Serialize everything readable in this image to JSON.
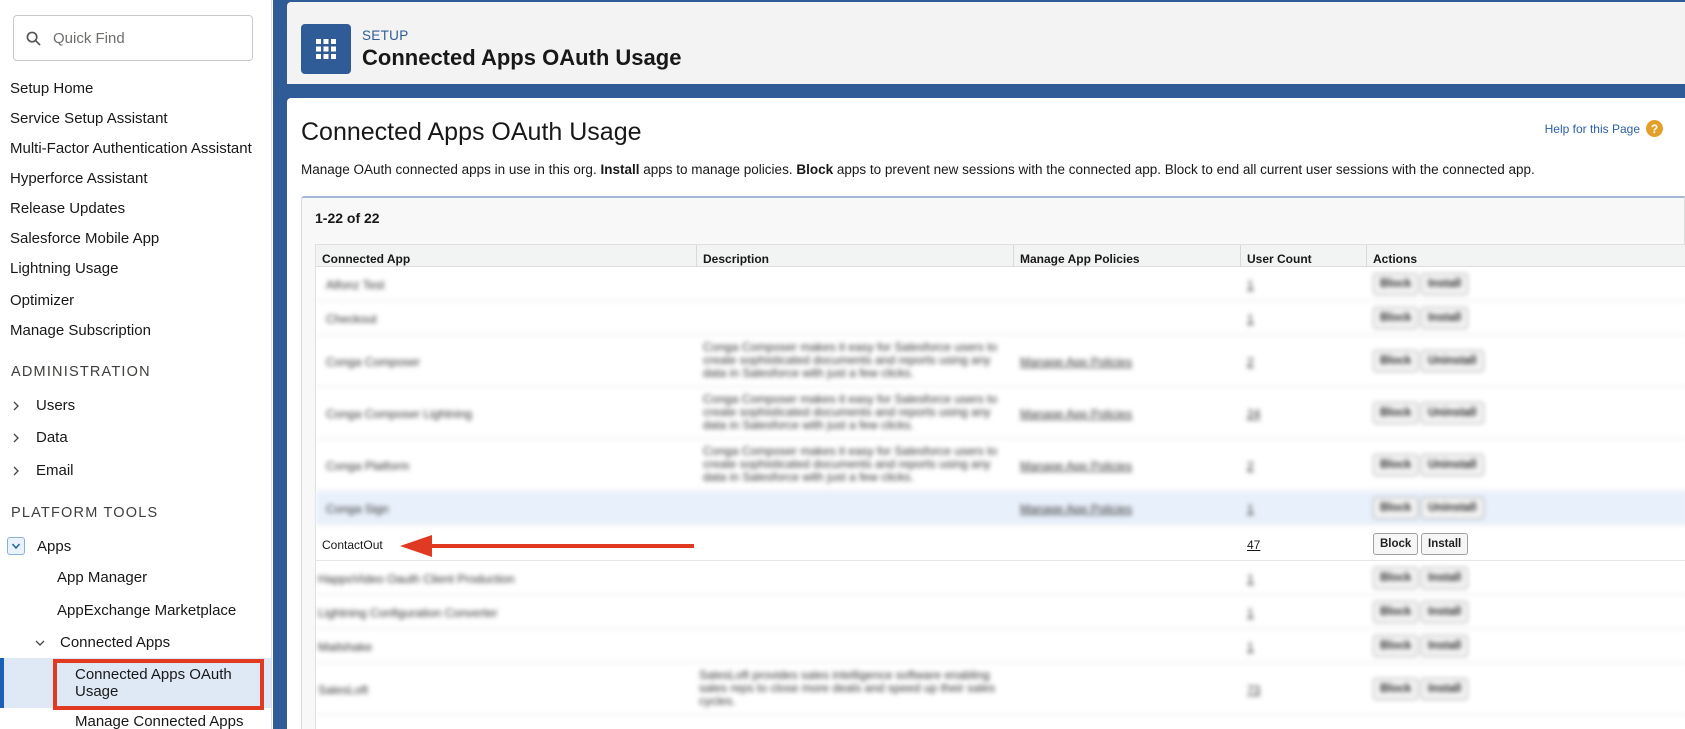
{
  "sidebar": {
    "quick_find_placeholder": "Quick Find",
    "top_items": [
      "Setup Home",
      "Service Setup Assistant",
      "Multi-Factor Authentication Assistant",
      "Hyperforce Assistant",
      "Release Updates",
      "Salesforce Mobile App",
      "Lightning Usage",
      "Optimizer",
      "Manage Subscription"
    ],
    "admin_heading": "ADMINISTRATION",
    "admin_items": [
      "Users",
      "Data",
      "Email"
    ],
    "platform_heading": "PLATFORM TOOLS",
    "apps_label": "Apps",
    "app_manager": "App Manager",
    "appexchange": "AppExchange Marketplace",
    "connected_apps": "Connected Apps",
    "selected": "Connected Apps OAuth Usage",
    "manage_connected": "Manage Connected Apps"
  },
  "header": {
    "crumb": "SETUP",
    "title": "Connected Apps OAuth Usage"
  },
  "page": {
    "title": "Connected Apps OAuth Usage",
    "help": "Help for this Page",
    "desc_1": "Manage OAuth connected apps in use in this org. ",
    "desc_install": "Install",
    "desc_2": " apps to manage policies. ",
    "desc_block": "Block",
    "desc_3": " apps to prevent new sessions with the connected app. Block to end all current user sessions with the connected app."
  },
  "table": {
    "range": "1-22 of 22",
    "columns": [
      "Connected App",
      "Description",
      "Manage App Policies",
      "User Count",
      "Actions"
    ],
    "rows": [
      {
        "app": "Alfonz Test",
        "desc": "",
        "policy": "",
        "count": "1",
        "a1": "Block",
        "a2": "Install"
      },
      {
        "app": "Checkout",
        "desc": "",
        "policy": "",
        "count": "1",
        "a1": "Block",
        "a2": "Install"
      },
      {
        "app": "Conga Composer",
        "desc": "Conga Composer makes it easy for Salesforce users to create sophisticated documents and reports using any data in Salesforce with just a few clicks.",
        "policy": "Manage App Policies",
        "count": "2",
        "a1": "Block",
        "a2": "Uninstall"
      },
      {
        "app": "Conga Composer Lightning",
        "desc": "Conga Composer makes it easy for Salesforce users to create sophisticated documents and reports using any data in Salesforce with just a few clicks.",
        "policy": "Manage App Policies",
        "count": "24",
        "a1": "Block",
        "a2": "Uninstall"
      },
      {
        "app": "Conga Platform",
        "desc": "Conga Composer makes it easy for Salesforce users to create sophisticated documents and reports using any data in Salesforce with just a few clicks.",
        "policy": "Manage App Policies",
        "count": "2",
        "a1": "Block",
        "a2": "Uninstall"
      },
      {
        "app": "Conga Sign",
        "desc": "",
        "policy": "Manage App Policies",
        "count": "1",
        "a1": "Block",
        "a2": "Uninstall"
      },
      {
        "app": "ContactOut",
        "desc": "",
        "policy": "",
        "count": "47",
        "a1": "Block",
        "a2": "Install"
      },
      {
        "app": "HappoVideo Oauth Client Production",
        "desc": "",
        "policy": "",
        "count": "1",
        "a1": "Block",
        "a2": "Install"
      },
      {
        "app": "Lightning Configuration Converter",
        "desc": "",
        "policy": "",
        "count": "1",
        "a1": "Block",
        "a2": "Install"
      },
      {
        "app": "Mailshake",
        "desc": "",
        "policy": "",
        "count": "1",
        "a1": "Block",
        "a2": "Install"
      },
      {
        "app": "SalesLoft",
        "desc": "SalesLoft provides sales intelligence software enabling sales reps to close more deals and speed up their sales cycles.",
        "policy": "",
        "count": "73",
        "a1": "Block",
        "a2": "Install"
      }
    ]
  },
  "colors": {
    "brand": "#2f5c97",
    "highlight": "#e03a22"
  }
}
